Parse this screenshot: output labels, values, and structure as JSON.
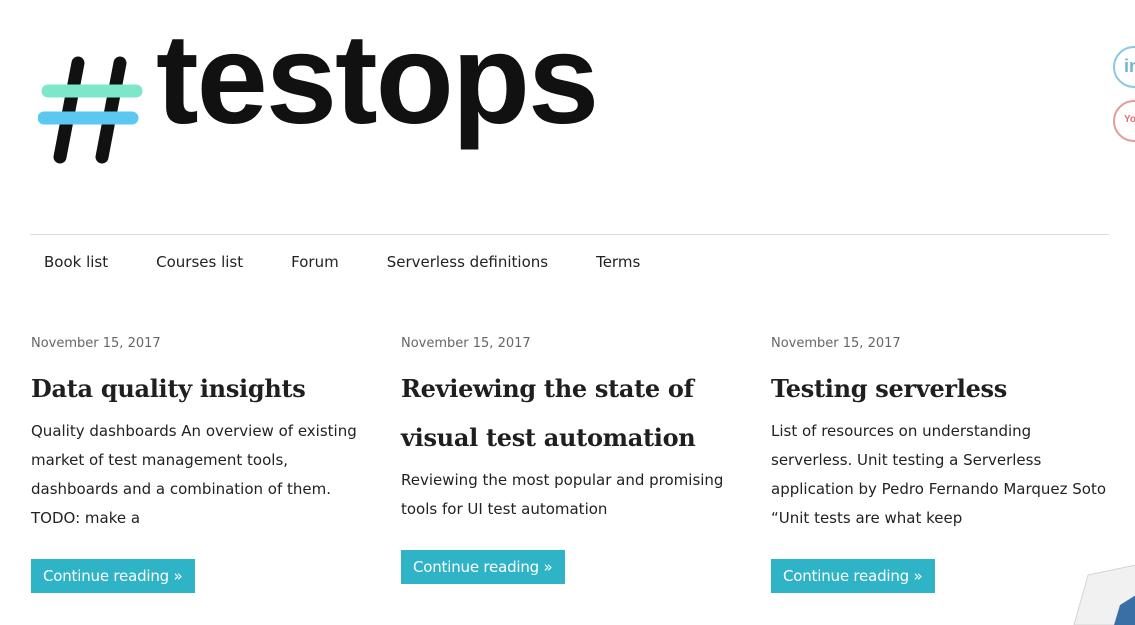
{
  "logo": {
    "text": "testops",
    "hash_colors": [
      "#7ee6c9",
      "#5bc8f2"
    ]
  },
  "social": [
    {
      "name": "linkedin",
      "glyph": "in"
    },
    {
      "name": "youtube",
      "glyph": "You"
    }
  ],
  "nav": {
    "items": [
      {
        "label": "Book list"
      },
      {
        "label": "Courses list"
      },
      {
        "label": "Forum"
      },
      {
        "label": "Serverless definitions"
      },
      {
        "label": "Terms"
      }
    ]
  },
  "posts": [
    {
      "date": "November 15, 2017",
      "title": "Data quality insights",
      "excerpt": "Quality dashboards An overview of existing market of test management tools, dashboards and a combination of them. TODO: make a",
      "button": "Continue reading »"
    },
    {
      "date": "November 15, 2017",
      "title": "Reviewing the state of visual test automation",
      "excerpt": "Reviewing the most popular and promising tools for UI test automation",
      "button": "Continue reading »"
    },
    {
      "date": "November 15, 2017",
      "title": "Testing serverless",
      "excerpt": "List of resources on understanding serverless. Unit testing a Serverless application by Pedro Fernando Marquez Soto “Unit tests are what keep",
      "button": "Continue reading »"
    }
  ],
  "colors": {
    "accent": "#2fb3c7"
  }
}
